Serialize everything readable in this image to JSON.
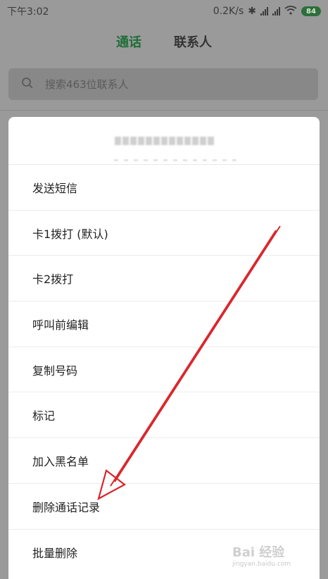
{
  "status_bar": {
    "time": "下午3:02",
    "net_speed": "0.2K/s",
    "battery": "84"
  },
  "tabs": [
    {
      "label": "通话",
      "active": true
    },
    {
      "label": "联系人",
      "active": false
    }
  ],
  "search": {
    "placeholder": "搜索463位联系人"
  },
  "dialog": {
    "items": [
      "发送短信",
      "卡1拨打 (默认)",
      "卡2拨打",
      "呼叫前编辑",
      "复制号码",
      "标记",
      "加入黑名单",
      "删除通话记录",
      "批量删除"
    ]
  },
  "watermark": {
    "brand": "Bai 经验",
    "url": "jingyan.baidu.com"
  },
  "colors": {
    "accent": "#1f6e37",
    "annotation": "#d9262c"
  }
}
